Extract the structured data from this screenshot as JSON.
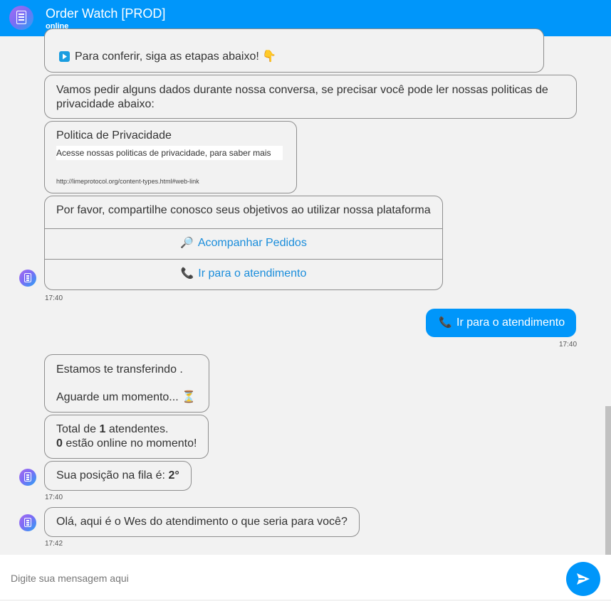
{
  "header": {
    "title": "Order Watch [PROD]",
    "status": "online",
    "logo_icon": "document-list-icon"
  },
  "messages": {
    "m1": {
      "text": "Para conferir, siga as etapas abaixo! 👇",
      "icon": "play-icon"
    },
    "m2": {
      "line1": "Vamos pedir alguns dados durante nossa conversa, se precisar você pode ler nossas politicas de",
      "line2": "privacidade abaixo:"
    },
    "link_card": {
      "title": "Politica de Privacidade",
      "description": "Acesse nossas politicas de privacidade, para saber mais",
      "url": "http://limeprotocol.org/content-types.html#web-link"
    },
    "menu": {
      "question": "Por favor, compartilhe conosco seus objetivos ao utilizar nossa plataforma",
      "option1_emoji": "🔎",
      "option1": "Acompanhar Pedidos",
      "option2_emoji": "📞",
      "option2": "Ir para o atendimento"
    },
    "time1": "17:40",
    "sent": {
      "emoji": "📞",
      "text": "Ir para o atendimento",
      "time": "17:40"
    },
    "transfer": {
      "line1": "Estamos te transferindo .",
      "line2": "Aguarde um momento... ⏳"
    },
    "total": {
      "prefix": "Total de ",
      "count": "1",
      "suffix": " atendentes.",
      "online_count": "0",
      "online_suffix": " estão online no momento!"
    },
    "queue": {
      "prefix": "Sua posição na fila é: ",
      "position": "2°"
    },
    "time2": "17:40",
    "agent": {
      "text": "Olá, aqui é o Wes do atendimento o que seria para você?"
    },
    "time3": "17:42"
  },
  "composer": {
    "placeholder": "Digite sua mensagem aqui",
    "send_icon": "send-arrow-icon"
  },
  "colors": {
    "brand": "#0096fa",
    "link": "#1a8ddb"
  }
}
